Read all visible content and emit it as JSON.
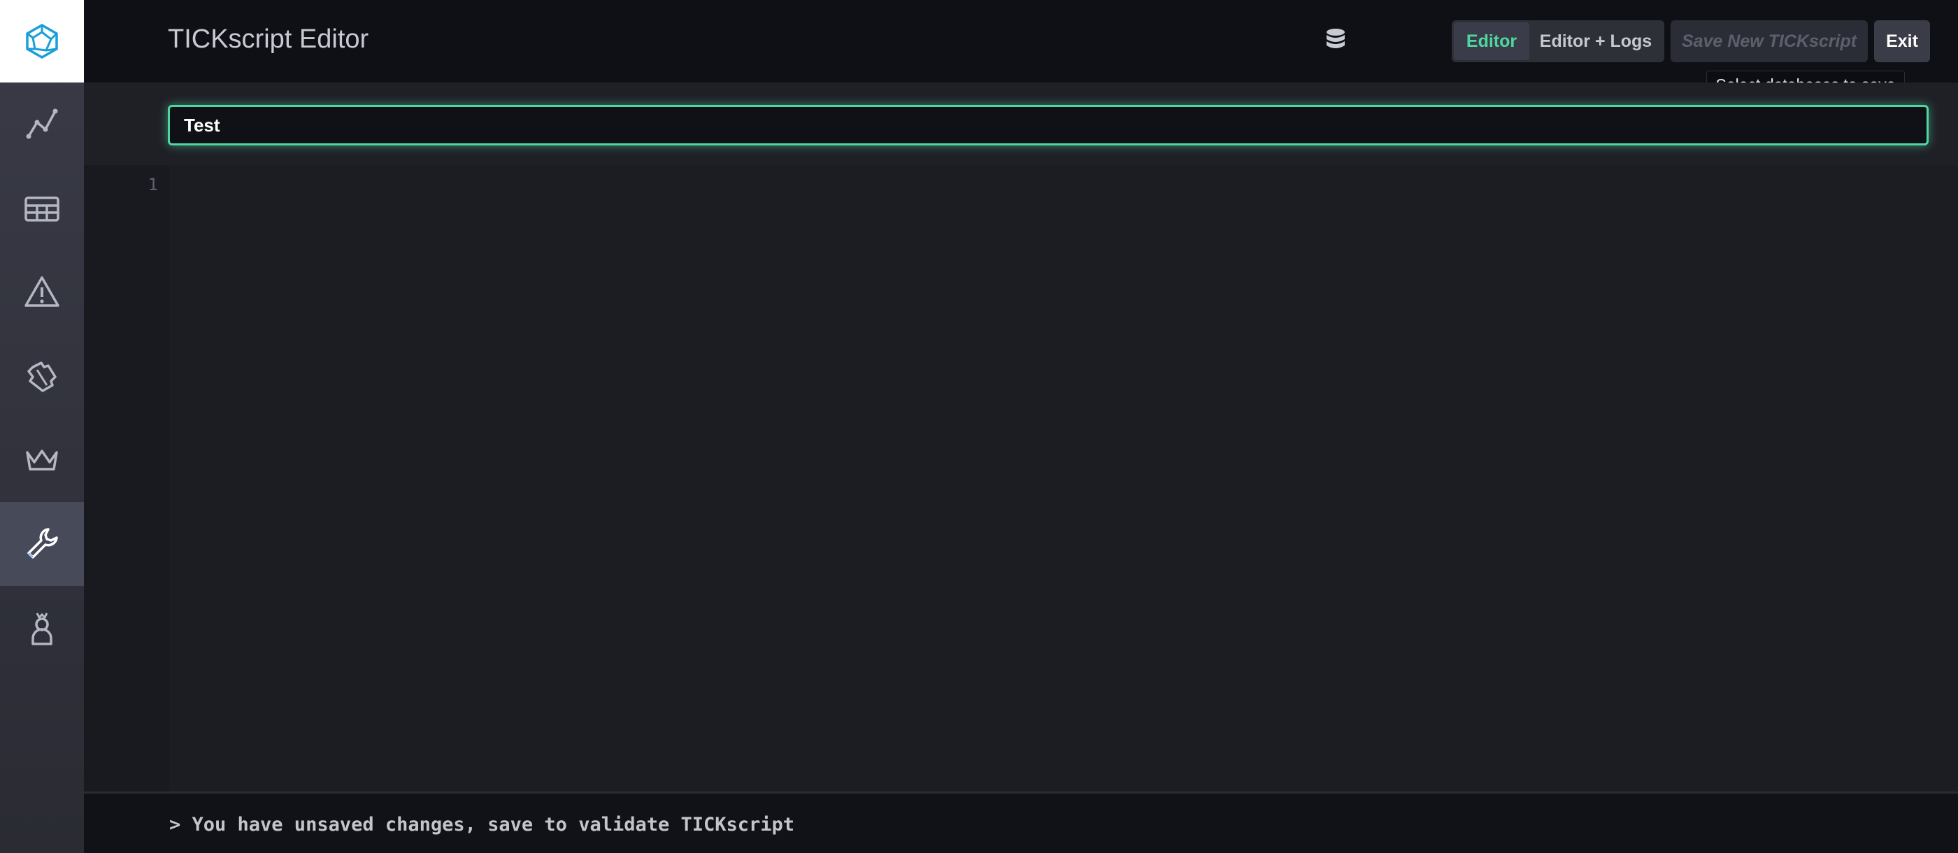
{
  "header": {
    "title": "TICKscript Editor",
    "toggle": {
      "editor_label": "Editor",
      "logs_label": "Editor + Logs",
      "selected": "Editor"
    },
    "save_label": "Save New TICKscript",
    "exit_label": "Exit",
    "tooltip": "Select databases to save",
    "database_icon": "database-icon"
  },
  "script": {
    "name_value": "Test"
  },
  "editor": {
    "line_numbers": [
      "1"
    ]
  },
  "status": {
    "message": "> You have unsaved changes, save to validate TICKscript"
  },
  "sidebar": {
    "items": [
      {
        "icon": "graph-icon",
        "active": false
      },
      {
        "icon": "table-icon",
        "active": false
      },
      {
        "icon": "alert-triangle-icon",
        "active": false
      },
      {
        "icon": "puzzle-icon",
        "active": false
      },
      {
        "icon": "crown-icon",
        "active": false
      },
      {
        "icon": "wrench-icon",
        "active": true
      },
      {
        "icon": "user-icon",
        "active": false
      }
    ]
  },
  "colors": {
    "accent": "#4ed8a0",
    "background": "#17181d",
    "sidebar": "#3a3b47"
  }
}
